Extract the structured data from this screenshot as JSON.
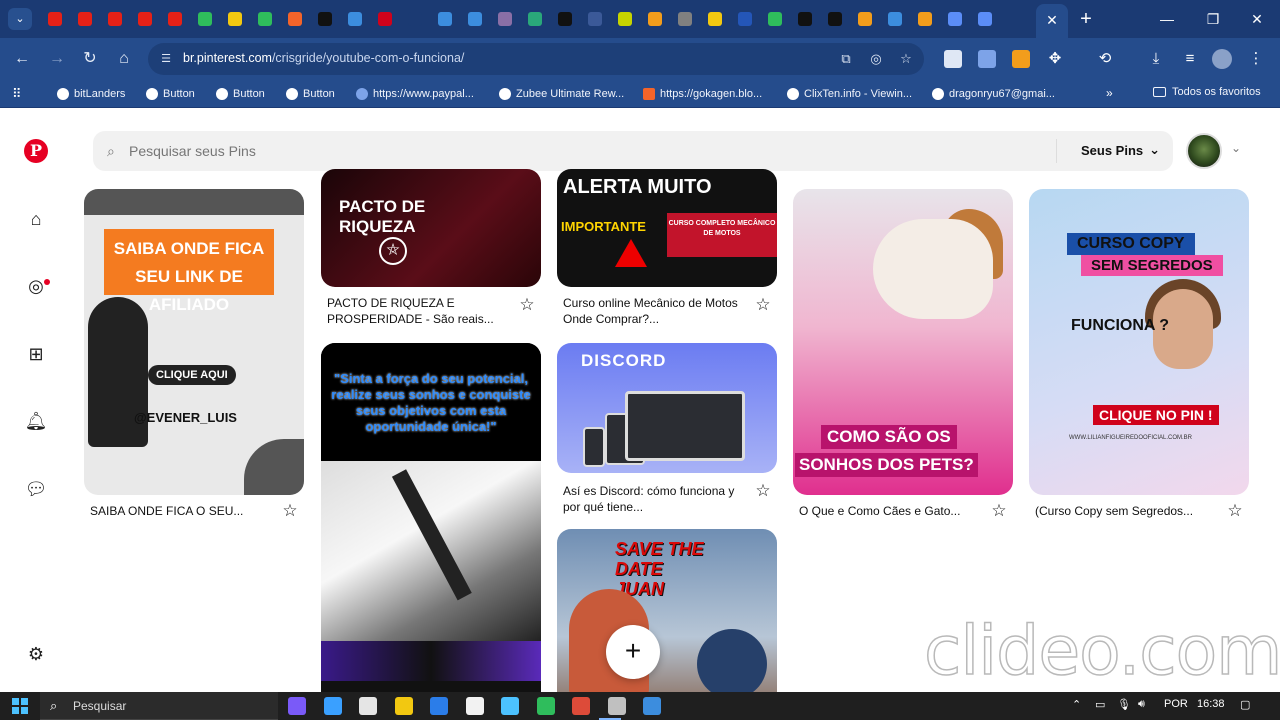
{
  "browser": {
    "tab_icon_colors": [
      "#e62117",
      "#e62117",
      "#e62117",
      "#e62117",
      "#e62117",
      "#2fbd5c",
      "#f2c811",
      "#2fbd5c",
      "#f4642a",
      "#111111",
      "#3c8dde",
      "#d0021b",
      "#1b3a73",
      "#3c8dde",
      "#3c8dde",
      "#8a6fa6",
      "#2aa87a",
      "#111111",
      "#3b5998",
      "#c7d400",
      "#f29d1c",
      "#808080",
      "#f2c811",
      "#2456b8",
      "#2fbd5c",
      "#111111",
      "#111111",
      "#f29d1c",
      "#3c8dde",
      "#f29d1c",
      "#5b8df7",
      "#5b8df7"
    ],
    "active_tab_close": "✕",
    "new_tab": "+",
    "window": {
      "minimize": "—",
      "restore": "❐",
      "close": "✕"
    },
    "url_domain": "br.pinterest.com",
    "url_path": "/crisgride/youtube-com-o-funciona/",
    "bookmarks": [
      {
        "label": "bitLanders"
      },
      {
        "label": "Button"
      },
      {
        "label": "Button"
      },
      {
        "label": "Button"
      },
      {
        "label": "https://www.paypal..."
      },
      {
        "label": "Zubee Ultimate Rew..."
      },
      {
        "label": "https://gokagen.blo..."
      },
      {
        "label": "ClixTen.info - Viewin..."
      },
      {
        "label": "dragonryu67@gmai..."
      }
    ],
    "bookmarks_more": "»",
    "bookmarks_folder": "Todos os favoritos"
  },
  "pinterest": {
    "logo": "P",
    "search_placeholder": "Pesquisar seus Pins",
    "seus_pins": "Seus Pins",
    "pins": [
      {
        "id": "afiliado",
        "title": "SAIBA ONDE FICA O SEU...",
        "art_band": "SAIBA ONDE FICA SEU LINK DE AFILIADO",
        "art_button": "CLIQUE AQUI",
        "art_handle": "@EVENER_LUIS"
      },
      {
        "id": "pacto",
        "title": "PACTO DE RIQUEZA E PROSPERIDADE - São reais...",
        "art_text": "PACTO DE RIQUEZA"
      },
      {
        "id": "mecanico",
        "title": "Curso online Mecânico de Motos Onde Comprar?...",
        "art_top": "ALERTA MUITO",
        "art_sub": "IMPORTANTE",
        "art_red": "CURSO COMPLETO MECÂNICO DE MOTOS"
      },
      {
        "id": "dog",
        "title": "O Que e Como Cães e Gato...",
        "art_line1": "COMO SÃO OS",
        "art_line2": "SONHOS DOS PETS?"
      },
      {
        "id": "copy",
        "title": "(Curso Copy sem Segredos...",
        "art_t1": "CURSO COPY",
        "art_t2": "SEM SEGREDOS",
        "art_t3": "FUNCIONA ?",
        "art_btn": "CLIQUE NO PIN !",
        "art_url": "WWW.LILIANFIGUEIREDOOFICIAL.COM.BR"
      },
      {
        "id": "guitar",
        "art_text": "\"Sinta a força do seu potencial, realize seus sonhos e conquiste seus objetivos com esta oportunidade única!\""
      },
      {
        "id": "discord",
        "title": "Así es Discord: cómo funciona y por qué tiene...",
        "art_logo": "DISCORD"
      },
      {
        "id": "savedate",
        "art_text": "SAVE THE DATE JUAN"
      }
    ],
    "create_button": "+"
  },
  "watermark": "clideo.com",
  "taskbar": {
    "search_label": "Pesquisar",
    "app_colors": [
      "#7a5af8",
      "#3aa0ff",
      "#e5e5e5",
      "#f2c811",
      "#2b7de9",
      "#f2f2f2",
      "#4cc2ff",
      "#2fbd5c",
      "#dd4b39",
      "#c0c0c0",
      "#3c8dde"
    ],
    "language": "POR",
    "time": "16:38"
  }
}
